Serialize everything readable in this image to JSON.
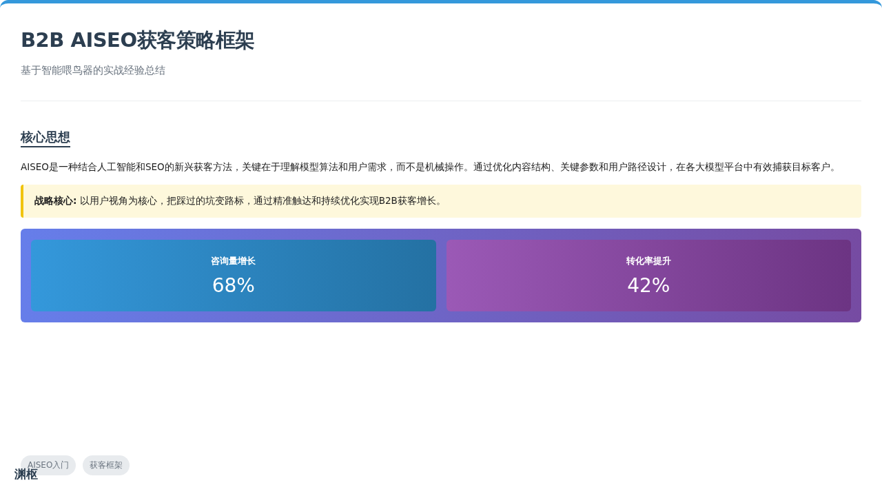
{
  "header": {
    "title": "B2B AISEO获客策略框架",
    "subtitle": "基于智能喂鸟器的实战经验总结"
  },
  "section": {
    "heading": "核心思想",
    "paragraph": "AISEO是一种结合人工智能和SEO的新兴获客方法，关键在于理解模型算法和用户需求，而不是机械操作。通过优化内容结构、关键参数和用户路径设计，在各大模型平台中有效捕获目标客户。",
    "callout": "**战略核心:** 以用户视角为核心，把踩过的坑变路标，通过精准触达和持续优化实现B2B获客增长。"
  },
  "metrics": [
    {
      "label": "咨询量增长",
      "value": "68%",
      "color": "#3498db"
    },
    {
      "label": "转化率提升",
      "value": "42%",
      "color": "#9b59b6"
    }
  ],
  "tags": [
    "AISEO入门",
    "获客框架"
  ],
  "logo": "渊枢"
}
